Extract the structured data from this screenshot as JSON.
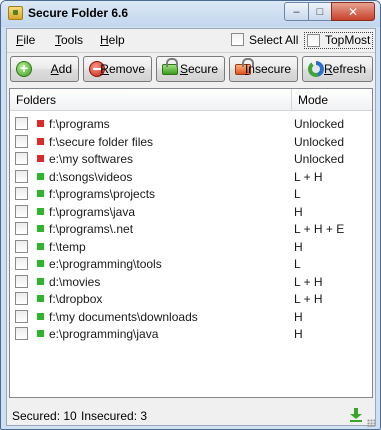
{
  "window": {
    "title": "Secure Folder 6.6",
    "minimize_glyph": "‒",
    "maximize_glyph": "□",
    "close_glyph": "✕"
  },
  "menu": {
    "file": "File",
    "tools": "Tools",
    "help": "Help",
    "select_all": "Select All",
    "select_all_checked": false,
    "topmost": "TopMost",
    "topmost_checked": false
  },
  "toolbar": {
    "add": "Add",
    "remove": "Remove",
    "secure": "Secure",
    "insecure": "Insecure",
    "refresh": "Refresh"
  },
  "list": {
    "col_folders": "Folders",
    "col_mode": "Mode",
    "rows": [
      {
        "folder": "f:\\programs",
        "mode": "Unlocked",
        "status": "insecure",
        "checked": false
      },
      {
        "folder": "f:\\secure folder files",
        "mode": "Unlocked",
        "status": "insecure",
        "checked": false
      },
      {
        "folder": "e:\\my softwares",
        "mode": "Unlocked",
        "status": "insecure",
        "checked": false
      },
      {
        "folder": "d:\\songs\\videos",
        "mode": "L + H",
        "status": "secure",
        "checked": false
      },
      {
        "folder": "f:\\programs\\projects",
        "mode": "L",
        "status": "secure",
        "checked": false
      },
      {
        "folder": "f:\\programs\\java",
        "mode": "H",
        "status": "secure",
        "checked": false
      },
      {
        "folder": "f:\\programs\\.net",
        "mode": "L + H + E",
        "status": "secure",
        "checked": false
      },
      {
        "folder": "f:\\temp",
        "mode": "H",
        "status": "secure",
        "checked": false
      },
      {
        "folder": "e:\\programming\\tools",
        "mode": "L",
        "status": "secure",
        "checked": false
      },
      {
        "folder": "d:\\movies",
        "mode": "L + H",
        "status": "secure",
        "checked": false
      },
      {
        "folder": "f:\\dropbox",
        "mode": "L + H",
        "status": "secure",
        "checked": false
      },
      {
        "folder": "f:\\my documents\\downloads",
        "mode": "H",
        "status": "secure",
        "checked": false
      },
      {
        "folder": "e:\\programming\\java",
        "mode": "H",
        "status": "secure",
        "checked": false
      }
    ]
  },
  "status": {
    "secured": "Secured: 10",
    "insecured": "Insecured: 3"
  },
  "colors": {
    "secure": "#2fb52c",
    "insecure": "#d92b2b"
  }
}
